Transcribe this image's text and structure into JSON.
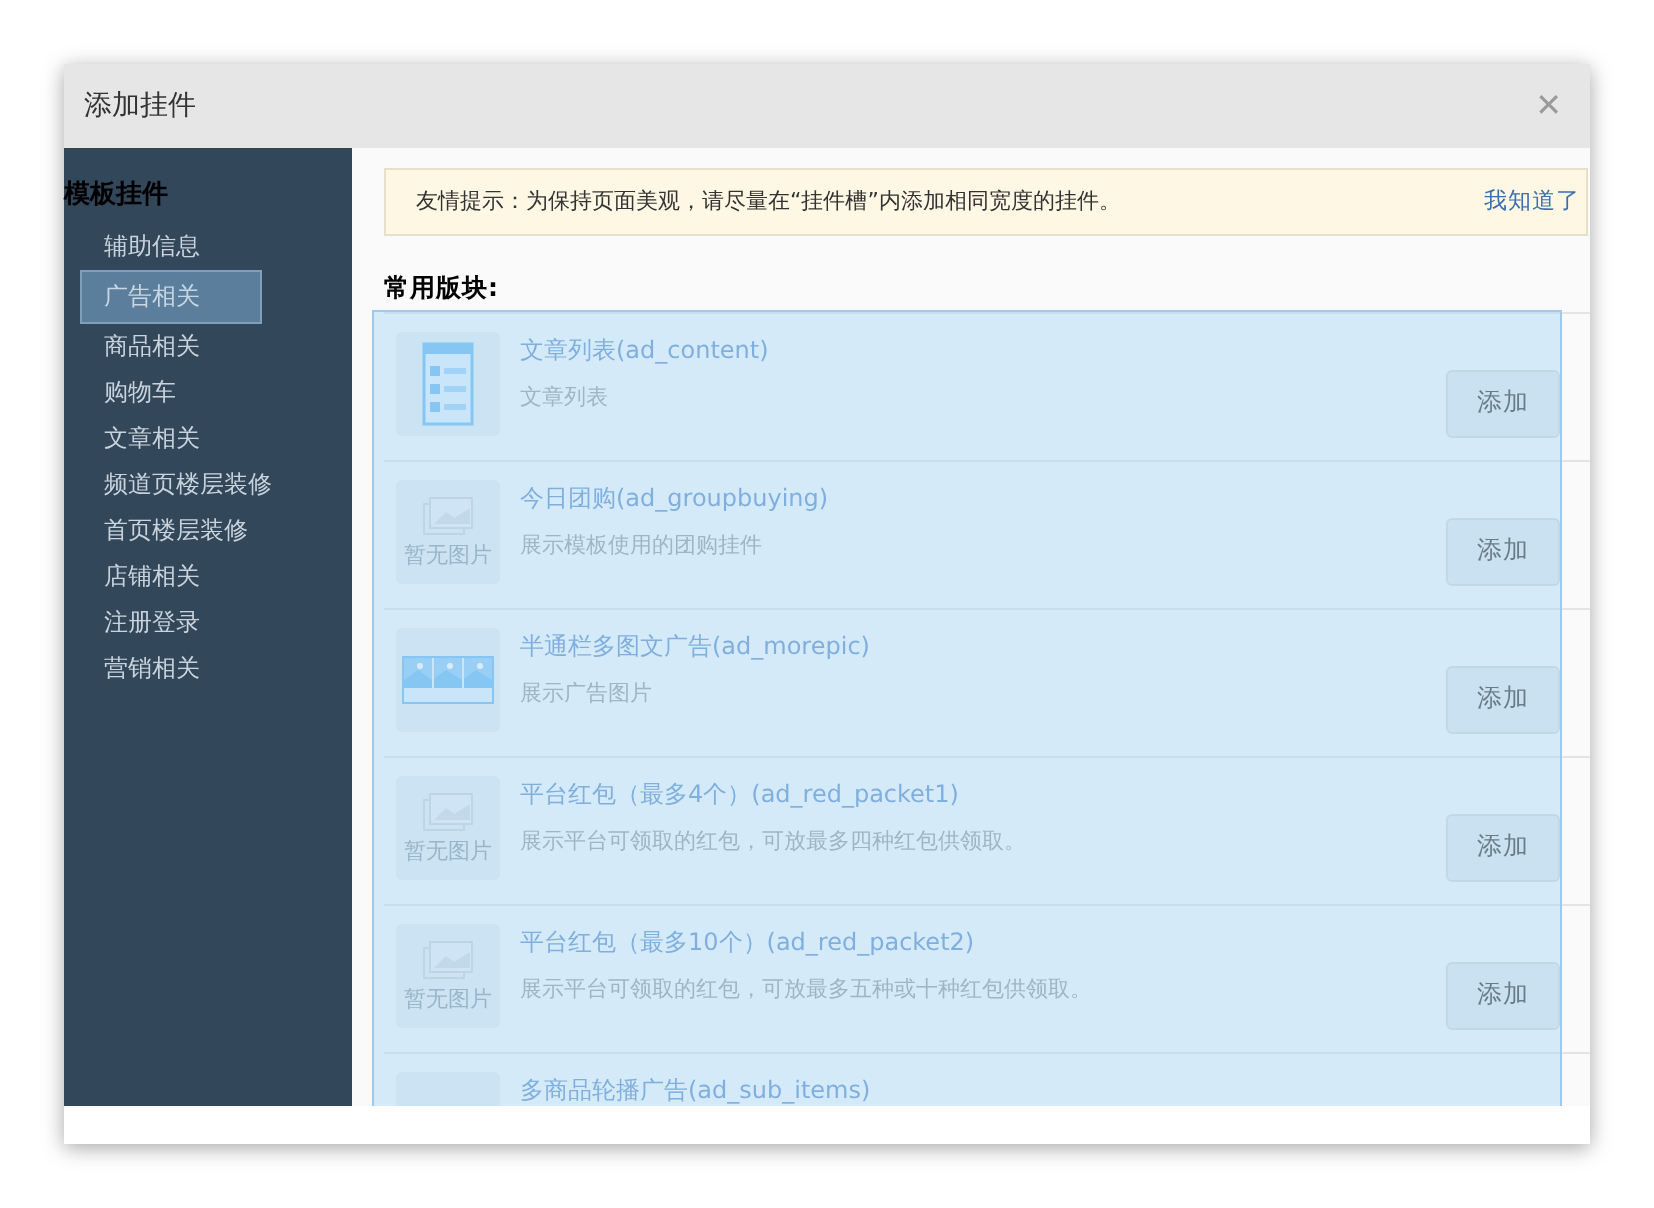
{
  "window": {
    "title": "添加挂件",
    "close": "✕"
  },
  "sidebar": {
    "title": "模板挂件",
    "items": [
      {
        "label": "辅助信息",
        "selected": false
      },
      {
        "label": "广告相关",
        "selected": true
      },
      {
        "label": "商品相关",
        "selected": false
      },
      {
        "label": "购物车",
        "selected": false
      },
      {
        "label": "文章相关",
        "selected": false
      },
      {
        "label": "频道页楼层装修",
        "selected": false
      },
      {
        "label": "首页楼层装修",
        "selected": false
      },
      {
        "label": "店铺相关",
        "selected": false
      },
      {
        "label": "注册登录",
        "selected": false
      },
      {
        "label": "营销相关",
        "selected": false
      }
    ]
  },
  "notice": {
    "text": "友情提示：为保持页面美观，请尽量在“挂件槽”内添加相同宽度的挂件。",
    "link": "我知道了"
  },
  "section_title": "常用版块:",
  "widgets": [
    {
      "kind": "list",
      "title": "文章列表(ad_content)",
      "description": "文章列表",
      "button": "添加"
    },
    {
      "kind": "none",
      "thumb_text": "暂无图片",
      "title": "今日团购(ad_groupbuying)",
      "description": "展示模板使用的团购挂件",
      "button": "添加"
    },
    {
      "kind": "multipic",
      "title": "半通栏多图文广告(ad_morepic)",
      "description": "展示广告图片",
      "button": "添加"
    },
    {
      "kind": "none",
      "thumb_text": "暂无图片",
      "title": "平台红包（最多4个）(ad_red_packet1)",
      "description": "展示平台可领取的红包，可放最多四种红包供领取。",
      "button": "添加"
    },
    {
      "kind": "none",
      "thumb_text": "暂无图片",
      "title": "平台红包（最多10个）(ad_red_packet2)",
      "description": "展示平台可领取的红包，可放最多五种或十种红包供领取。",
      "button": "添加"
    },
    {
      "kind": "blank",
      "title": "多商品轮播广告(ad_sub_items)"
    }
  ]
}
